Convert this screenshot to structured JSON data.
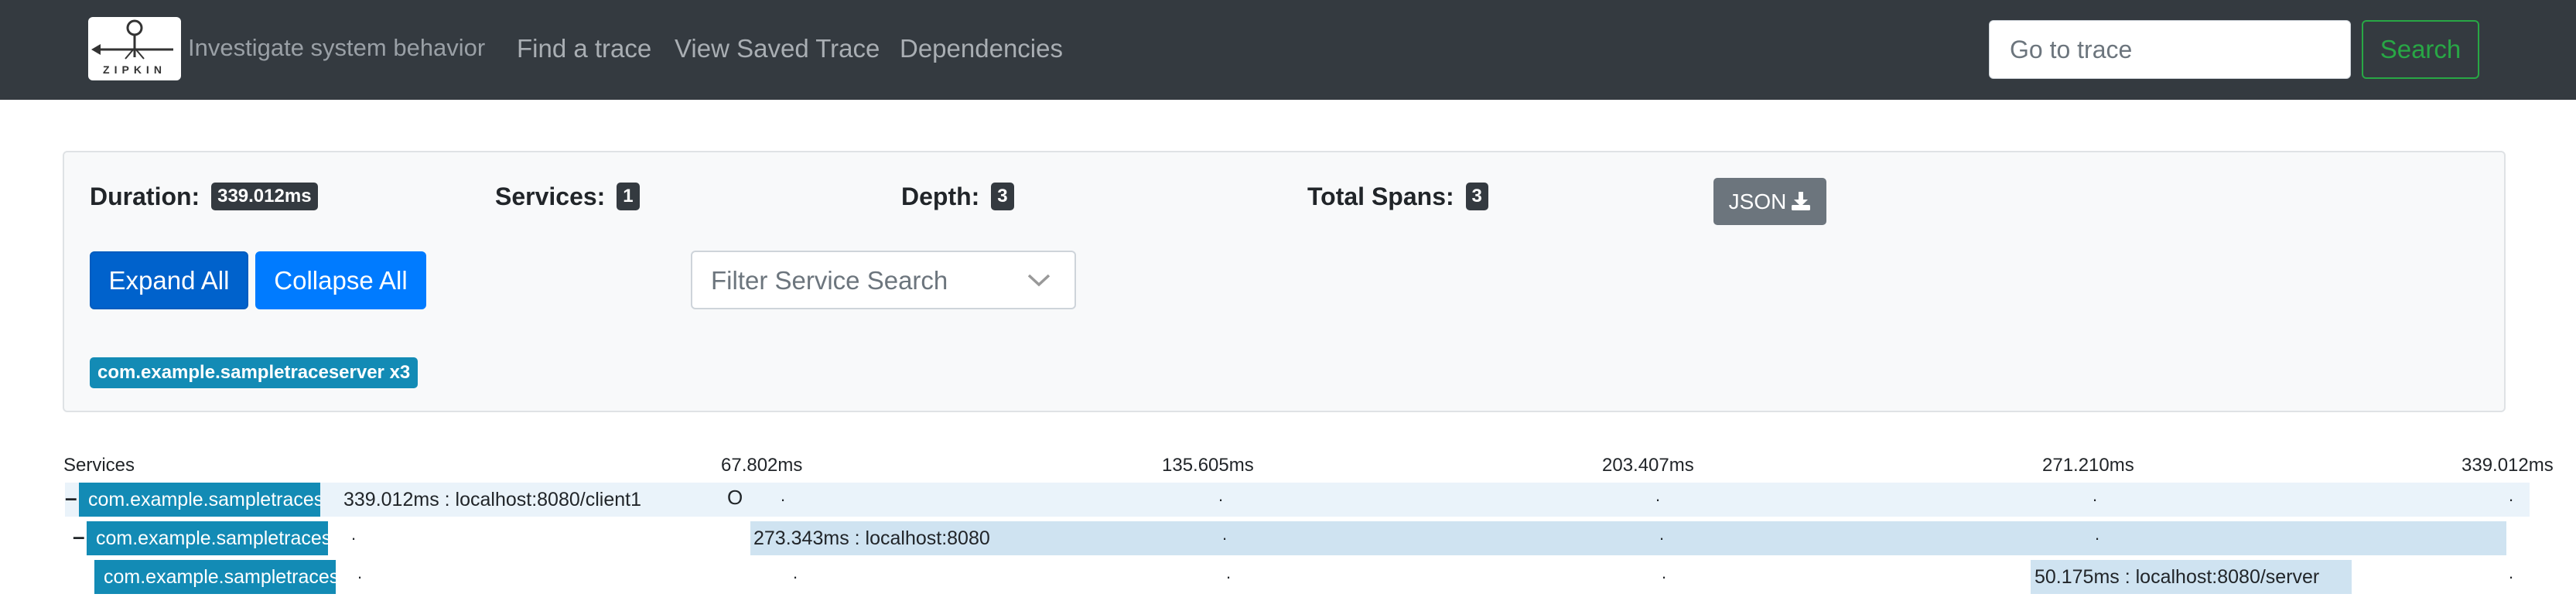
{
  "navbar": {
    "logo_text": "ZIPKIN",
    "tagline": "Investigate system behavior",
    "links": [
      "Find a trace",
      "View Saved Trace",
      "Dependencies"
    ],
    "goto_placeholder": "Go to trace",
    "search_label": "Search"
  },
  "summary": {
    "duration_label": "Duration:",
    "duration_value": "339.012ms",
    "services_label": "Services:",
    "services_value": "1",
    "depth_label": "Depth:",
    "depth_value": "3",
    "spans_label": "Total Spans:",
    "spans_value": "3",
    "json_label": "JSON",
    "expand_label": "Expand All",
    "collapse_label": "Collapse All",
    "filter_placeholder": "Filter Service Search",
    "service_badge": "com.example.sampletraceserver x3"
  },
  "timeline": {
    "services_header": "Services",
    "ticks": [
      "67.802ms",
      "135.605ms",
      "203.407ms",
      "271.210ms",
      "339.012ms"
    ],
    "spans": [
      {
        "service": "com.example.sampletraceserver",
        "label": "339.012ms : localhost:8080/client1",
        "toggle": "–",
        "annotation": "O"
      },
      {
        "service": "com.example.sampletraceserver",
        "label": "273.343ms : localhost:8080",
        "toggle": "–"
      },
      {
        "service": "com.example.sampletraceserver",
        "label": "50.175ms : localhost:8080/server",
        "toggle": ""
      }
    ]
  },
  "colors": {
    "navbar": "#343a40",
    "service_accent": "#138bb5",
    "primary_dark": "#0062cc",
    "primary": "#007bff",
    "success": "#28a745",
    "span_bar": "#cfe3f1"
  },
  "icons": {
    "json": "download-icon",
    "filter": "chevron-down-icon",
    "logo": "zipkin-logo"
  }
}
